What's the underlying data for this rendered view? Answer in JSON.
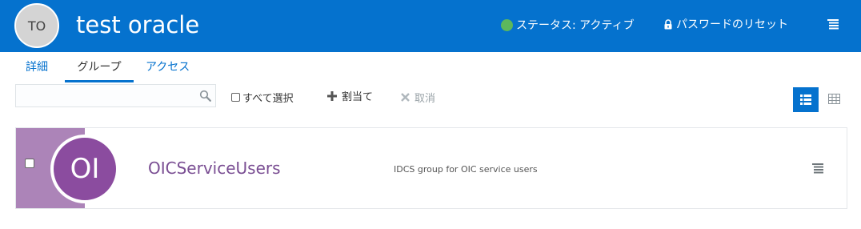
{
  "header": {
    "avatar_initials": "TO",
    "user_name": "test oracle",
    "status_text": "ステータス: アクティブ",
    "status_color": "#5cb85c",
    "reset_password_label": "パスワードのリセット",
    "background_color": "#0572ce"
  },
  "tabs": [
    {
      "label": "詳細",
      "active": false
    },
    {
      "label": "グループ",
      "active": true
    },
    {
      "label": "アクセス",
      "active": false
    }
  ],
  "toolbar": {
    "search_value": "",
    "search_placeholder": "",
    "select_all_label": "すべて選択",
    "assign_label": "割当て",
    "cancel_label": "取消"
  },
  "view_toggle": {
    "active": "list"
  },
  "groups": [
    {
      "initials": "OI",
      "name": "OICServiceUsers",
      "description": "IDCS group for OIC service users",
      "avatar_color": "#8b4c9f",
      "band_color": "#ac84b8"
    }
  ]
}
